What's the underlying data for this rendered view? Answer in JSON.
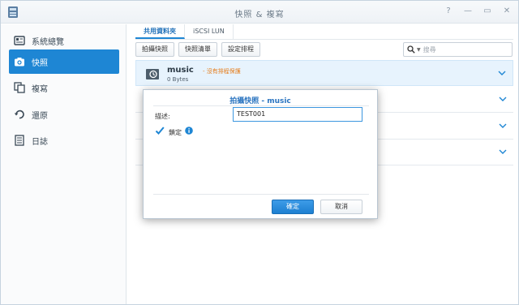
{
  "window": {
    "title": "快照 & 複寫",
    "controls": [
      "?",
      "—",
      "▭",
      "✕"
    ]
  },
  "sidebar": {
    "items": [
      {
        "label": "系統總覽",
        "icon": "overview-icon",
        "active": false
      },
      {
        "label": "快照",
        "icon": "camera-icon",
        "active": true
      },
      {
        "label": "複寫",
        "icon": "replicate-icon",
        "active": false
      },
      {
        "label": "還原",
        "icon": "restore-icon",
        "active": false
      },
      {
        "label": "日誌",
        "icon": "log-icon",
        "active": false
      }
    ]
  },
  "tabs": [
    {
      "label": "共用資料夾",
      "active": true
    },
    {
      "label": "iSCSI LUN",
      "active": false
    }
  ],
  "toolbar": {
    "take_snapshot": "拍攝快照",
    "snapshot_list": "快照清單",
    "set_schedule": "設定排程"
  },
  "search": {
    "placeholder": "搜尋"
  },
  "shares": [
    {
      "name": "music",
      "note": "- 沒有排程保護",
      "size": "0 Bytes"
    }
  ],
  "dialog": {
    "title": "拍攝快照 - music",
    "description_label": "描述:",
    "description_value": "TEST001",
    "lock_label": "鎖定",
    "lock_checked": true,
    "ok_label": "確定",
    "cancel_label": "取消"
  },
  "colors": {
    "accent": "#1e86d4",
    "note": "#e57c1a",
    "selected_row": "#e7f3fd"
  }
}
